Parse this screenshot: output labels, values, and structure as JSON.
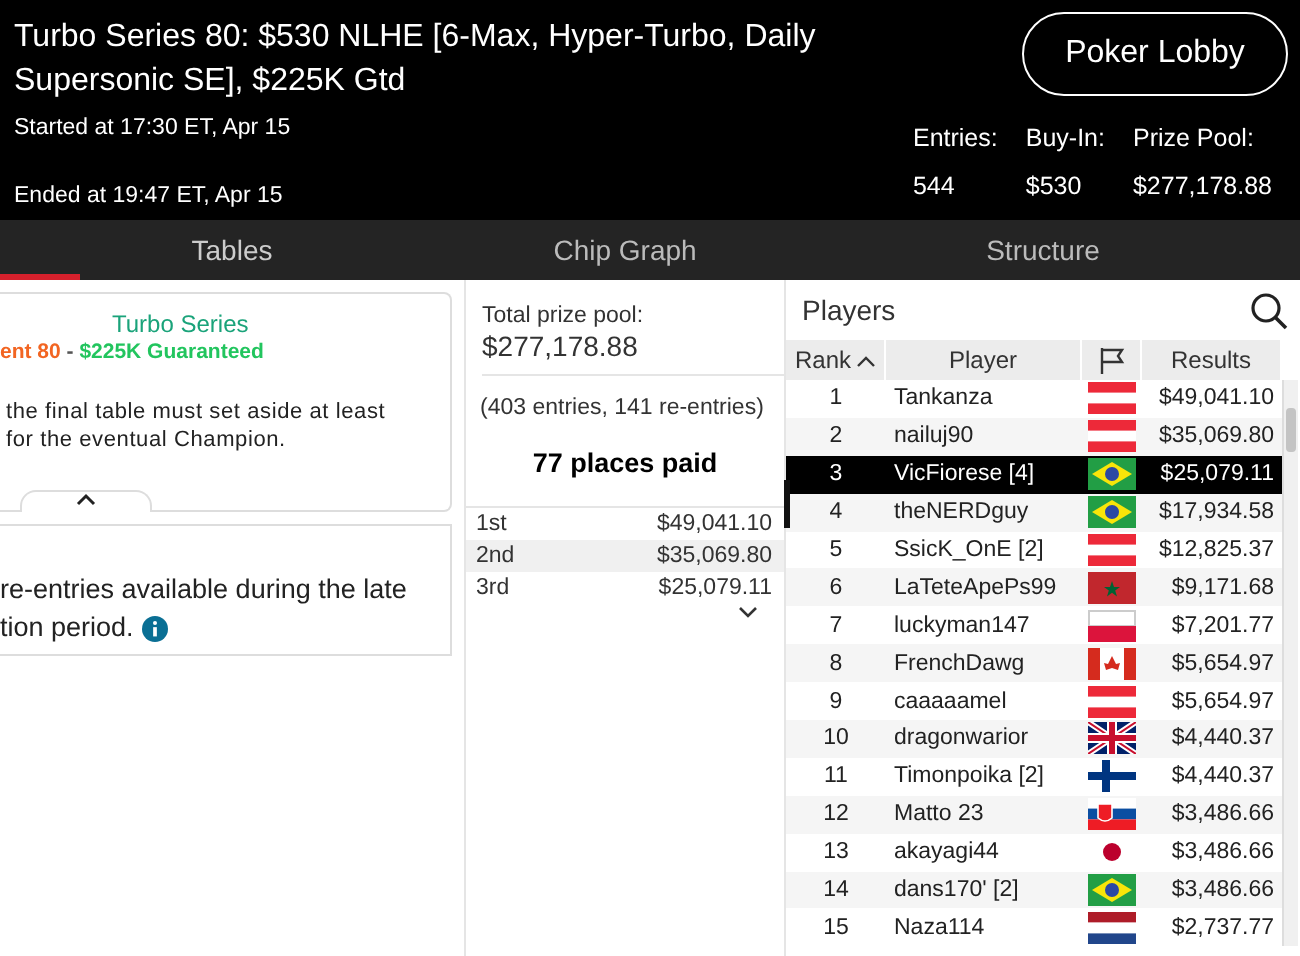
{
  "header": {
    "title": "Turbo Series 80: $530 NLHE [6-Max, Hyper-Turbo, Daily Supersonic SE], $225K Gtd",
    "started": "Started at 17:30 ET, Apr 15",
    "ended": "Ended at 19:47 ET, Apr 15",
    "lobby_button": "Poker Lobby",
    "stats": [
      {
        "label": "Entries:",
        "value": "544"
      },
      {
        "label": "Buy-In:",
        "value": "$530"
      },
      {
        "label": "Prize Pool:",
        "value": "$277,178.88"
      }
    ]
  },
  "tabs": [
    {
      "label": "Tables",
      "selected": true
    },
    {
      "label": "Chip Graph",
      "selected": false
    },
    {
      "label": "Structure",
      "selected": false
    }
  ],
  "info_card": {
    "series": "Turbo Series",
    "subtitle": [
      {
        "kind": "event",
        "text": "ent 80"
      },
      {
        "kind": "separator",
        "text": " - "
      },
      {
        "kind": "guarantee",
        "text": "$225K Guaranteed"
      }
    ],
    "lines": [
      "the final table must set aside at least",
      "for the eventual Champion."
    ],
    "expanded": true
  },
  "reentry_card": {
    "lines": [
      "re-entries available during the late",
      "tion period."
    ]
  },
  "prizes": {
    "total_label": "Total prize pool:",
    "total": "$277,178.88",
    "entries": "(403 entries, 141 re-entries)",
    "places_paid": "77 places paid",
    "rows": [
      {
        "place": "1st",
        "amount": "$49,041.10"
      },
      {
        "place": "2nd",
        "amount": "$35,069.80"
      },
      {
        "place": "3rd",
        "amount": "$25,079.11"
      }
    ]
  },
  "players": {
    "title": "Players",
    "columns": [
      "Rank",
      "Player",
      "Results"
    ],
    "rows": [
      {
        "rank": "1",
        "player": "Tankanza",
        "kind": "austria",
        "result": "$49,041.10",
        "selected": false
      },
      {
        "rank": "2",
        "player": "nailuj90",
        "kind": "austria",
        "result": "$35,069.80",
        "selected": false
      },
      {
        "rank": "3",
        "player": "VicFiorese [4]",
        "kind": "brazil",
        "result": "$25,079.11",
        "selected": true
      },
      {
        "rank": "4",
        "player": "theNERDguy",
        "kind": "brazil",
        "result": "$17,934.58",
        "selected": false
      },
      {
        "rank": "5",
        "player": "SsicK_OnE [2]",
        "kind": "austria",
        "result": "$12,825.37",
        "selected": false
      },
      {
        "rank": "6",
        "player": "LaTeteApePs99",
        "kind": "morocco",
        "result": "$9,171.68",
        "selected": false
      },
      {
        "rank": "7",
        "player": "luckyman147",
        "kind": "poland",
        "result": "$7,201.77",
        "selected": false
      },
      {
        "rank": "8",
        "player": "FrenchDawg",
        "kind": "canada",
        "result": "$5,654.97",
        "selected": false
      },
      {
        "rank": "9",
        "player": "caaaaamel",
        "kind": "austria",
        "result": "$5,654.97",
        "selected": false
      },
      {
        "rank": "10",
        "player": "dragonwarior",
        "kind": "uk",
        "result": "$4,440.37",
        "selected": false
      },
      {
        "rank": "11",
        "player": "Timonpoika [2]",
        "kind": "finland",
        "result": "$4,440.37",
        "selected": false
      },
      {
        "rank": "12",
        "player": "Matto 23",
        "kind": "slovakia",
        "result": "$3,486.66",
        "selected": false
      },
      {
        "rank": "13",
        "player": "akayagi44",
        "kind": "japan",
        "result": "$3,486.66",
        "selected": false
      },
      {
        "rank": "14",
        "player": "dans170' [2]",
        "kind": "brazil",
        "result": "$3,486.66",
        "selected": false
      },
      {
        "rank": "15",
        "player": "Naza114",
        "kind": "netherlands",
        "result": "$2,737.77",
        "selected": false
      }
    ]
  }
}
